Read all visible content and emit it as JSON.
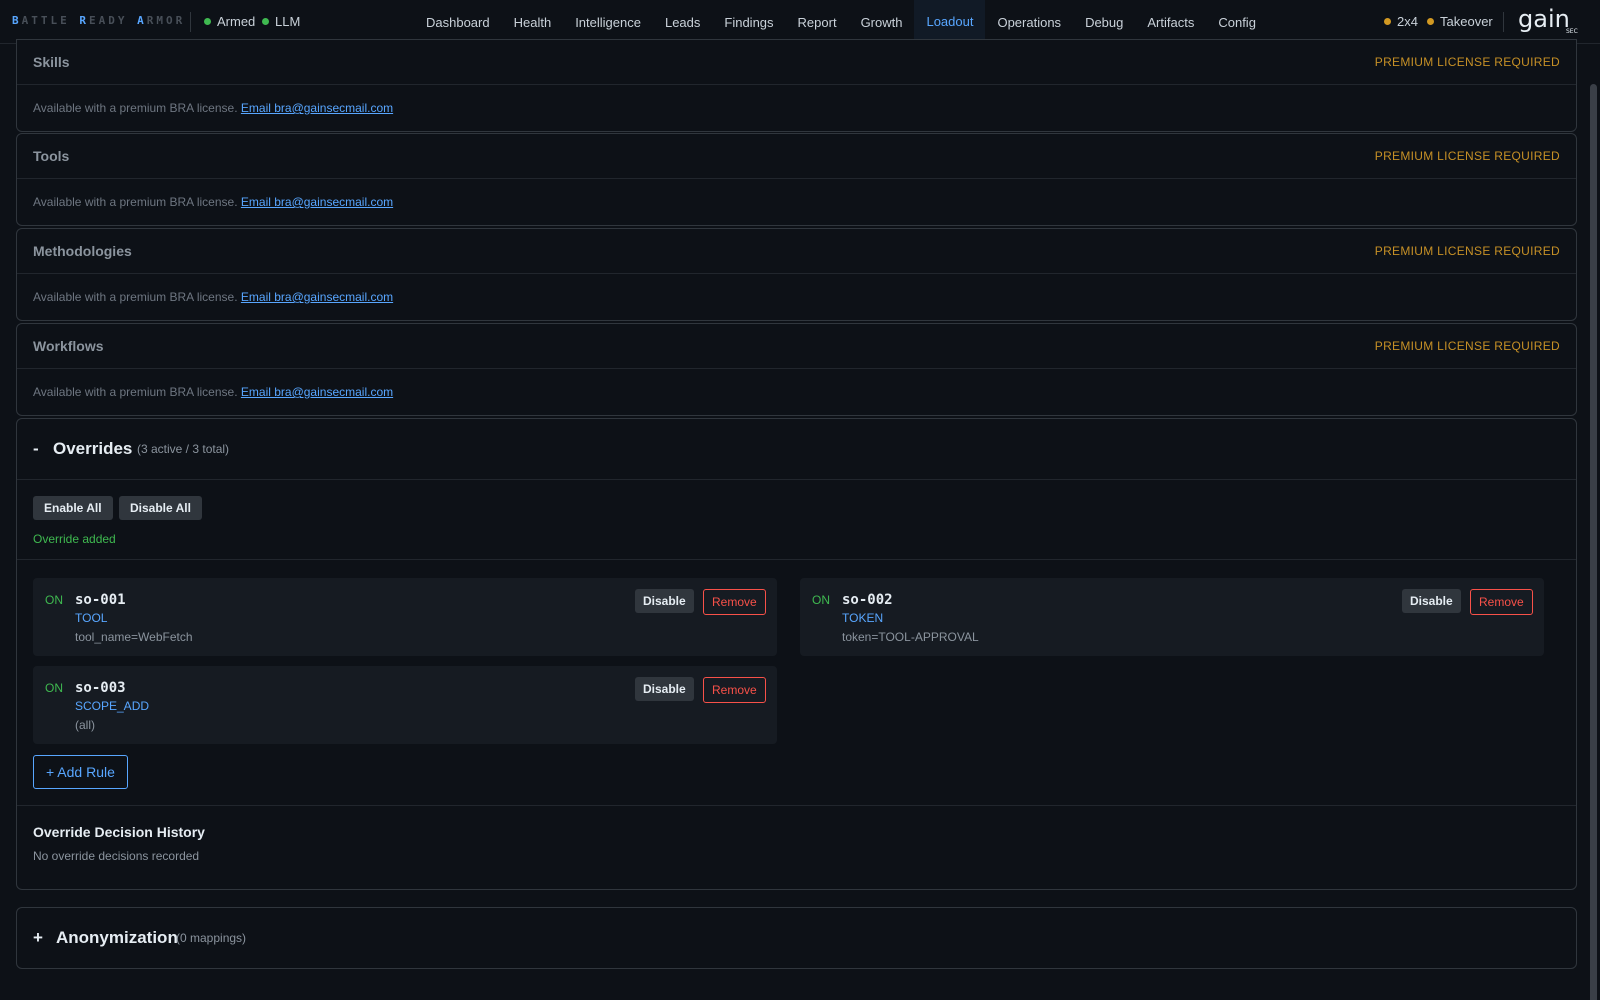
{
  "header": {
    "brand": [
      {
        "cap": "B",
        "rest": "ATTLE "
      },
      {
        "cap": "R",
        "rest": "EADY "
      },
      {
        "cap": "A",
        "rest": "RMOR"
      }
    ],
    "status_left": [
      {
        "label": "Armed",
        "color": "#3fb950"
      },
      {
        "label": "LLM",
        "color": "#3fb950"
      }
    ],
    "nav": [
      {
        "label": "Dashboard",
        "active": false
      },
      {
        "label": "Health",
        "active": false
      },
      {
        "label": "Intelligence",
        "active": false
      },
      {
        "label": "Leads",
        "active": false
      },
      {
        "label": "Findings",
        "active": false
      },
      {
        "label": "Report",
        "active": false
      },
      {
        "label": "Growth",
        "active": false
      },
      {
        "label": "Loadout",
        "active": true
      },
      {
        "label": "Operations",
        "active": false
      },
      {
        "label": "Debug",
        "active": false
      },
      {
        "label": "Artifacts",
        "active": false
      },
      {
        "label": "Config",
        "active": false
      }
    ],
    "status_right": [
      {
        "label": "2x4",
        "color": "#d29922"
      },
      {
        "label": "Takeover",
        "color": "#d29922"
      }
    ],
    "logo_text": "gain",
    "logo_sub": "SEC"
  },
  "licensed_sections": [
    {
      "title": "Skills",
      "badge": "PREMIUM LICENSE REQUIRED",
      "text": "Available with a premium BRA license.",
      "link": "Email bra@gainsecmail.com"
    },
    {
      "title": "Tools",
      "badge": "PREMIUM LICENSE REQUIRED",
      "text": "Available with a premium BRA license.",
      "link": "Email bra@gainsecmail.com"
    },
    {
      "title": "Methodologies",
      "badge": "PREMIUM LICENSE REQUIRED",
      "text": "Available with a premium BRA license.",
      "link": "Email bra@gainsecmail.com"
    },
    {
      "title": "Workflows",
      "badge": "PREMIUM LICENSE REQUIRED",
      "text": "Available with a premium BRA license.",
      "link": "Email bra@gainsecmail.com"
    }
  ],
  "overrides": {
    "toggle": "-",
    "title": "Overrides",
    "count": "(3 active / 3 total)",
    "enable_all": "Enable All",
    "disable_all": "Disable All",
    "message": "Override added",
    "rules": [
      {
        "state": "ON",
        "id": "so-001",
        "type": "TOOL",
        "detail": "tool_name=WebFetch",
        "disable": "Disable",
        "remove": "Remove"
      },
      {
        "state": "ON",
        "id": "so-002",
        "type": "TOKEN",
        "detail": "token=TOOL-APPROVAL",
        "disable": "Disable",
        "remove": "Remove"
      },
      {
        "state": "ON",
        "id": "so-003",
        "type": "SCOPE_ADD",
        "detail": "(all)",
        "disable": "Disable",
        "remove": "Remove"
      }
    ],
    "add_rule": "+ Add Rule",
    "history_title": "Override Decision History",
    "history_empty": "No override decisions recorded"
  },
  "anonymization": {
    "toggle": "+",
    "title": "Anonymization",
    "count": "(0 mappings)"
  }
}
